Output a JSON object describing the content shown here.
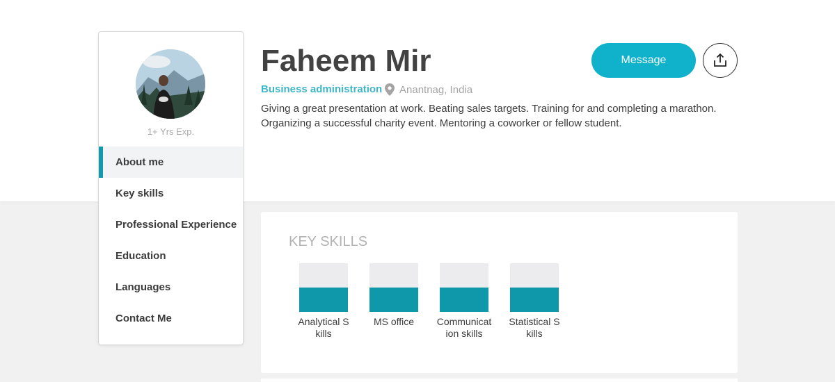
{
  "profile": {
    "name": "Faheem Mir",
    "role": "Business administration",
    "location": "Anantnag, India",
    "bio": "Giving a great presentation at work. Beating sales targets. Training for and completing a marathon. Organizing a successful charity event. Mentoring a coworker or fellow student.",
    "experience": "1+ Yrs Exp."
  },
  "actions": {
    "message_label": "Message",
    "share_icon": "share-upload-icon"
  },
  "sidebar": {
    "items": [
      {
        "label": "About me",
        "active": true
      },
      {
        "label": "Key skills",
        "active": false
      },
      {
        "label": "Professional Experience",
        "active": false
      },
      {
        "label": "Education",
        "active": false
      },
      {
        "label": "Languages",
        "active": false
      },
      {
        "label": "Contact Me",
        "active": false
      }
    ]
  },
  "skills": {
    "title": "KEY SKILLS",
    "items": [
      {
        "label": "Analytical Skills",
        "level": 0.5
      },
      {
        "label": "MS office",
        "level": 0.5
      },
      {
        "label": "Communication skills",
        "level": 0.5
      },
      {
        "label": "Statistical Skills",
        "level": 0.5
      }
    ]
  },
  "colors": {
    "accent": "#10b2cb",
    "skill_fill": "#0f98aa",
    "role_text": "#3fb7c9"
  }
}
